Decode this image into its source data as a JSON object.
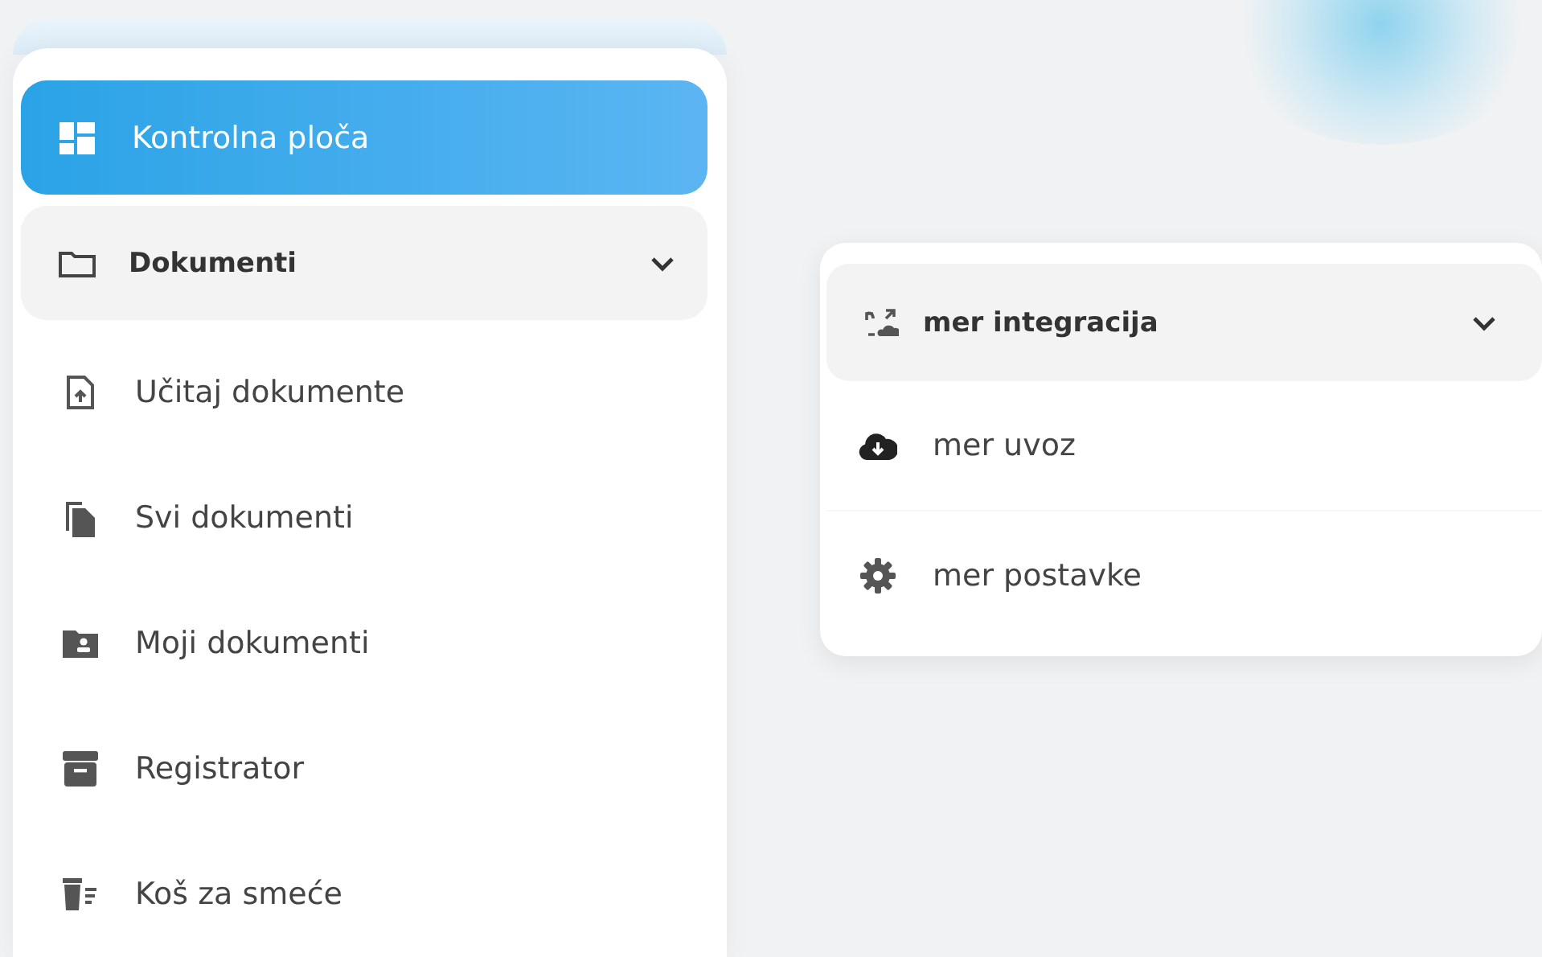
{
  "sidebar": {
    "items": [
      {
        "label": "Kontrolna ploča",
        "selected": true
      },
      {
        "label": "Dokumenti",
        "selected": false,
        "expanded": true,
        "children": [
          {
            "label": "Učitaj dokumente",
            "selected": false
          },
          {
            "label": "Svi dokumenti",
            "selected": false
          },
          {
            "label": "Moji dokumenti",
            "selected": false
          },
          {
            "label": "Registrator",
            "selected": false
          },
          {
            "label": "Koš za smeće",
            "selected": false
          }
        ]
      }
    ]
  },
  "integration_menu": {
    "label": "mer integracija",
    "expanded": true,
    "children": [
      {
        "label": "mer uvoz",
        "selected": false
      },
      {
        "label": "mer postavke",
        "selected": false
      }
    ]
  }
}
